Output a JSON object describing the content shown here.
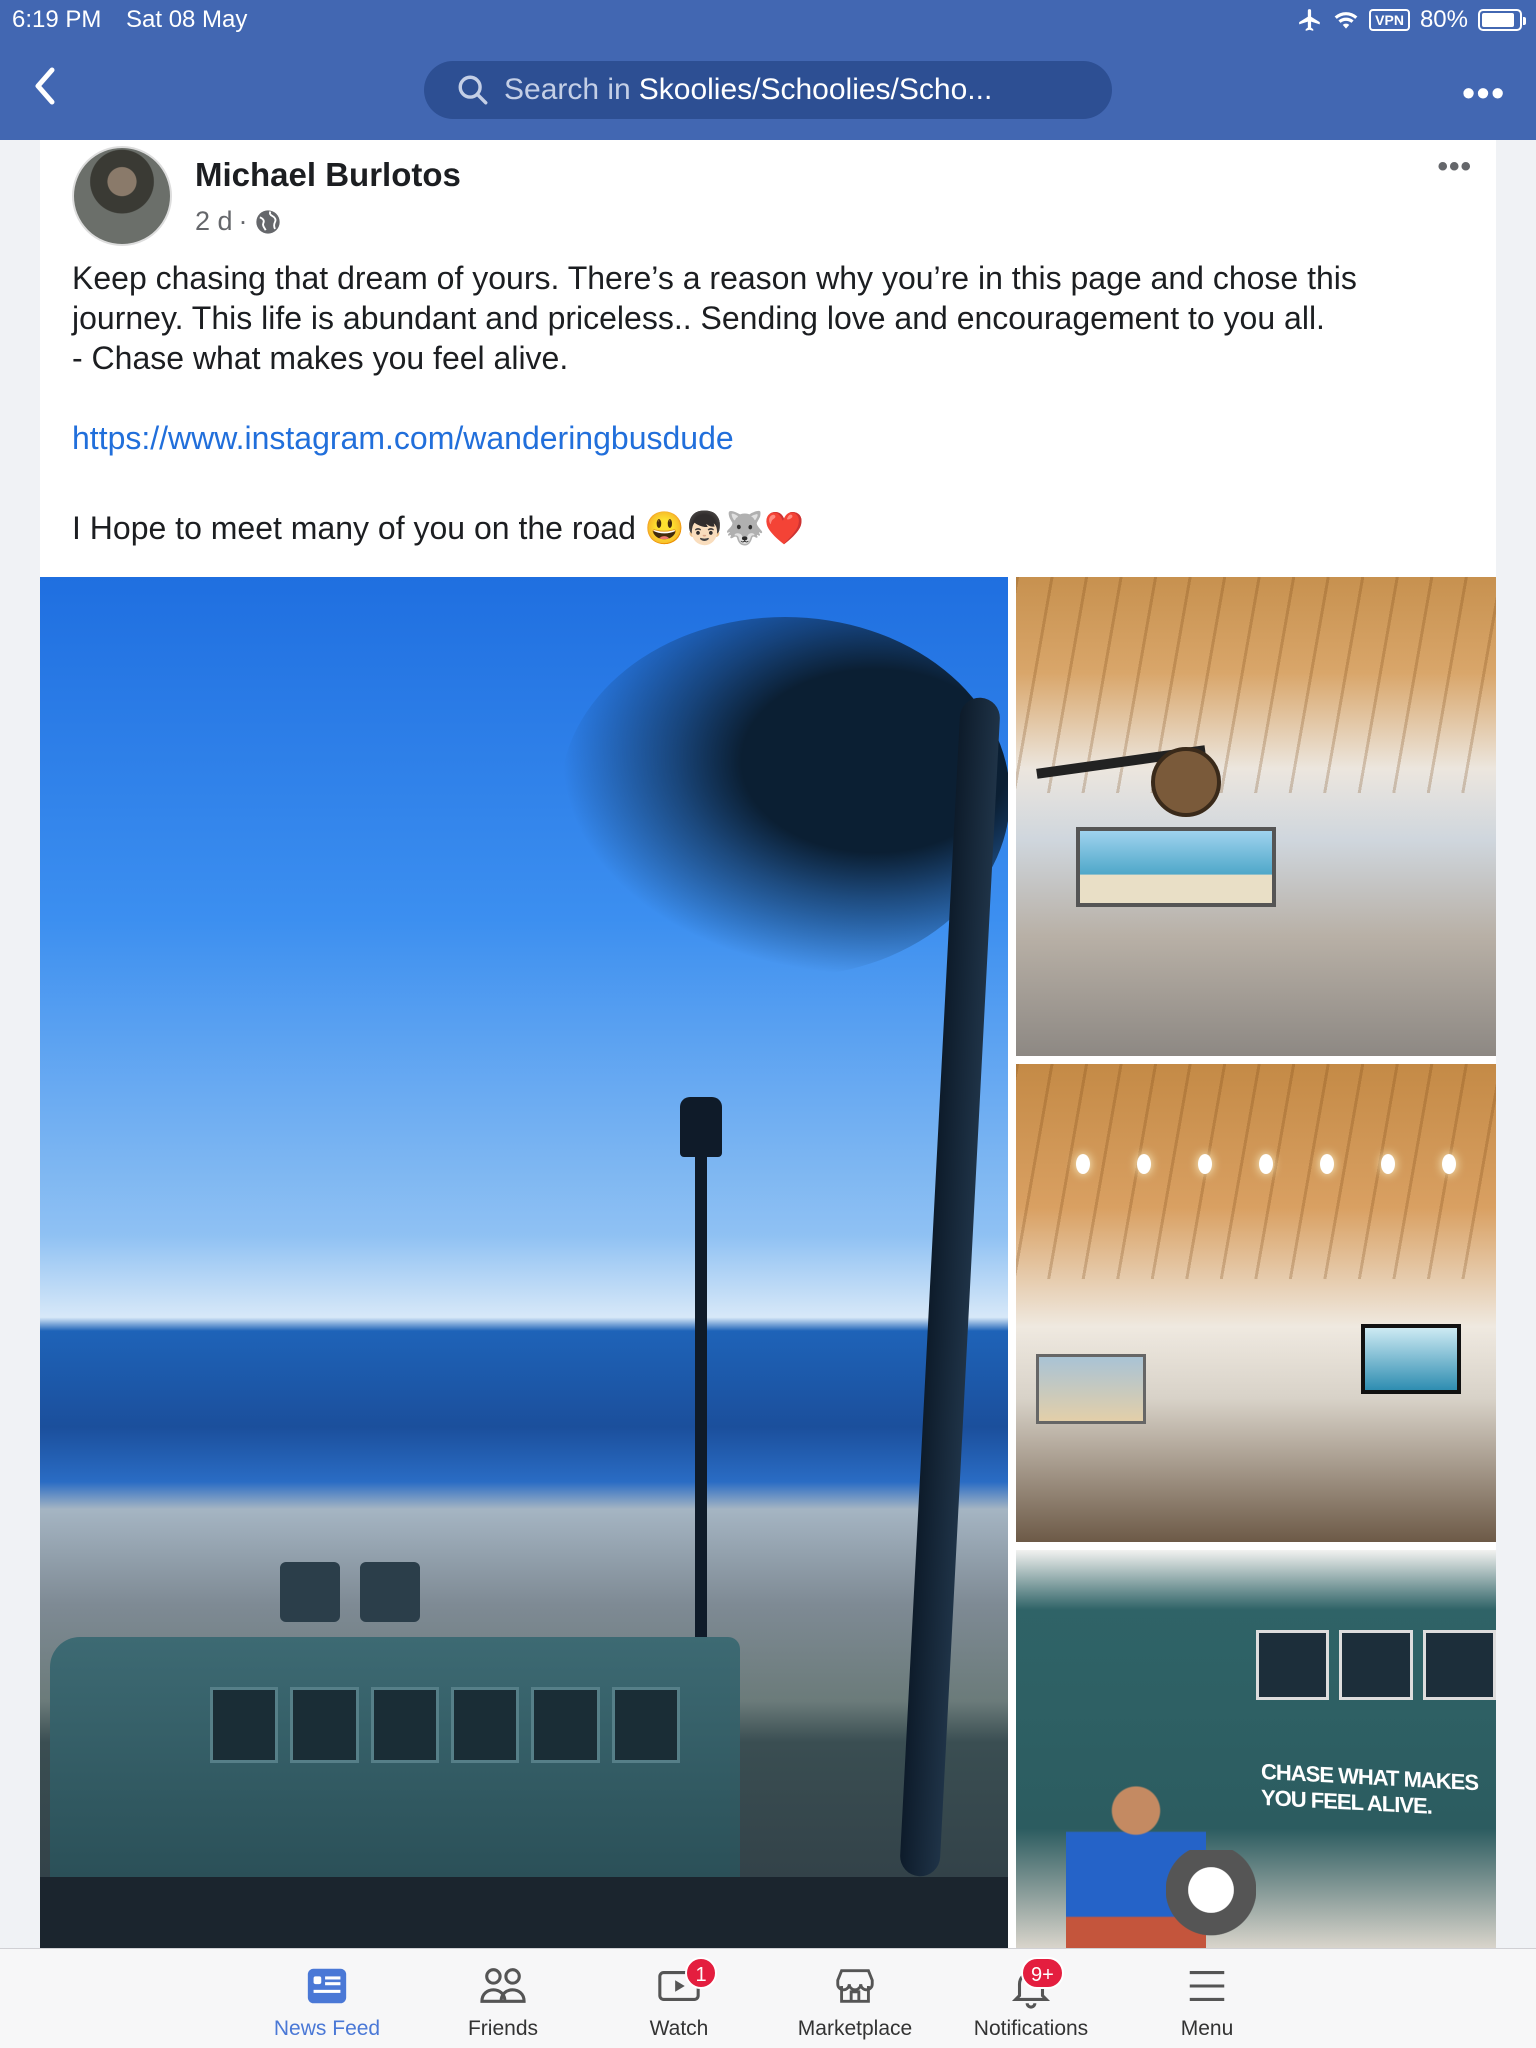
{
  "status_bar": {
    "time": "6:19 PM",
    "date": "Sat 08 May",
    "vpn": "VPN",
    "battery": "80%"
  },
  "nav": {
    "search_prefix": "Search in",
    "group_name": "Skoolies/Schoolies/Scho...",
    "more": "•••"
  },
  "post": {
    "author": "Michael Burlotos",
    "time": "2 d",
    "privacy_separator": "·",
    "more": "•••",
    "text_line1": "Keep chasing that dream of yours. There’s a reason why you’re in this page and chose this",
    "text_line2": "journey. This life is abundant and priceless.. Sending love and encouragement to you all.",
    "text_line3": "- Chase what makes you feel alive.",
    "link": "https://www.instagram.com/wanderingbusdude",
    "closing": "I Hope to meet many of you on the road",
    "emojis": "😃👦🏻🐺❤️",
    "photo4_slogan": "CHASE WHAT MAKES YOU FEEL ALIVE."
  },
  "tabbar": {
    "tabs": [
      {
        "label": "News Feed",
        "icon": "news-feed-icon",
        "active": true
      },
      {
        "label": "Friends",
        "icon": "friends-icon"
      },
      {
        "label": "Watch",
        "icon": "watch-icon",
        "badge": "1"
      },
      {
        "label": "Marketplace",
        "icon": "marketplace-icon"
      },
      {
        "label": "Notifications",
        "icon": "bell-icon",
        "badge": "9+"
      },
      {
        "label": "Menu",
        "icon": "hamburger-menu-icon"
      }
    ]
  },
  "colors": {
    "header_blue": "#4267b2",
    "link_blue": "#216fdb",
    "active_tab": "#4a78d6",
    "badge_red": "#e41e3f"
  }
}
